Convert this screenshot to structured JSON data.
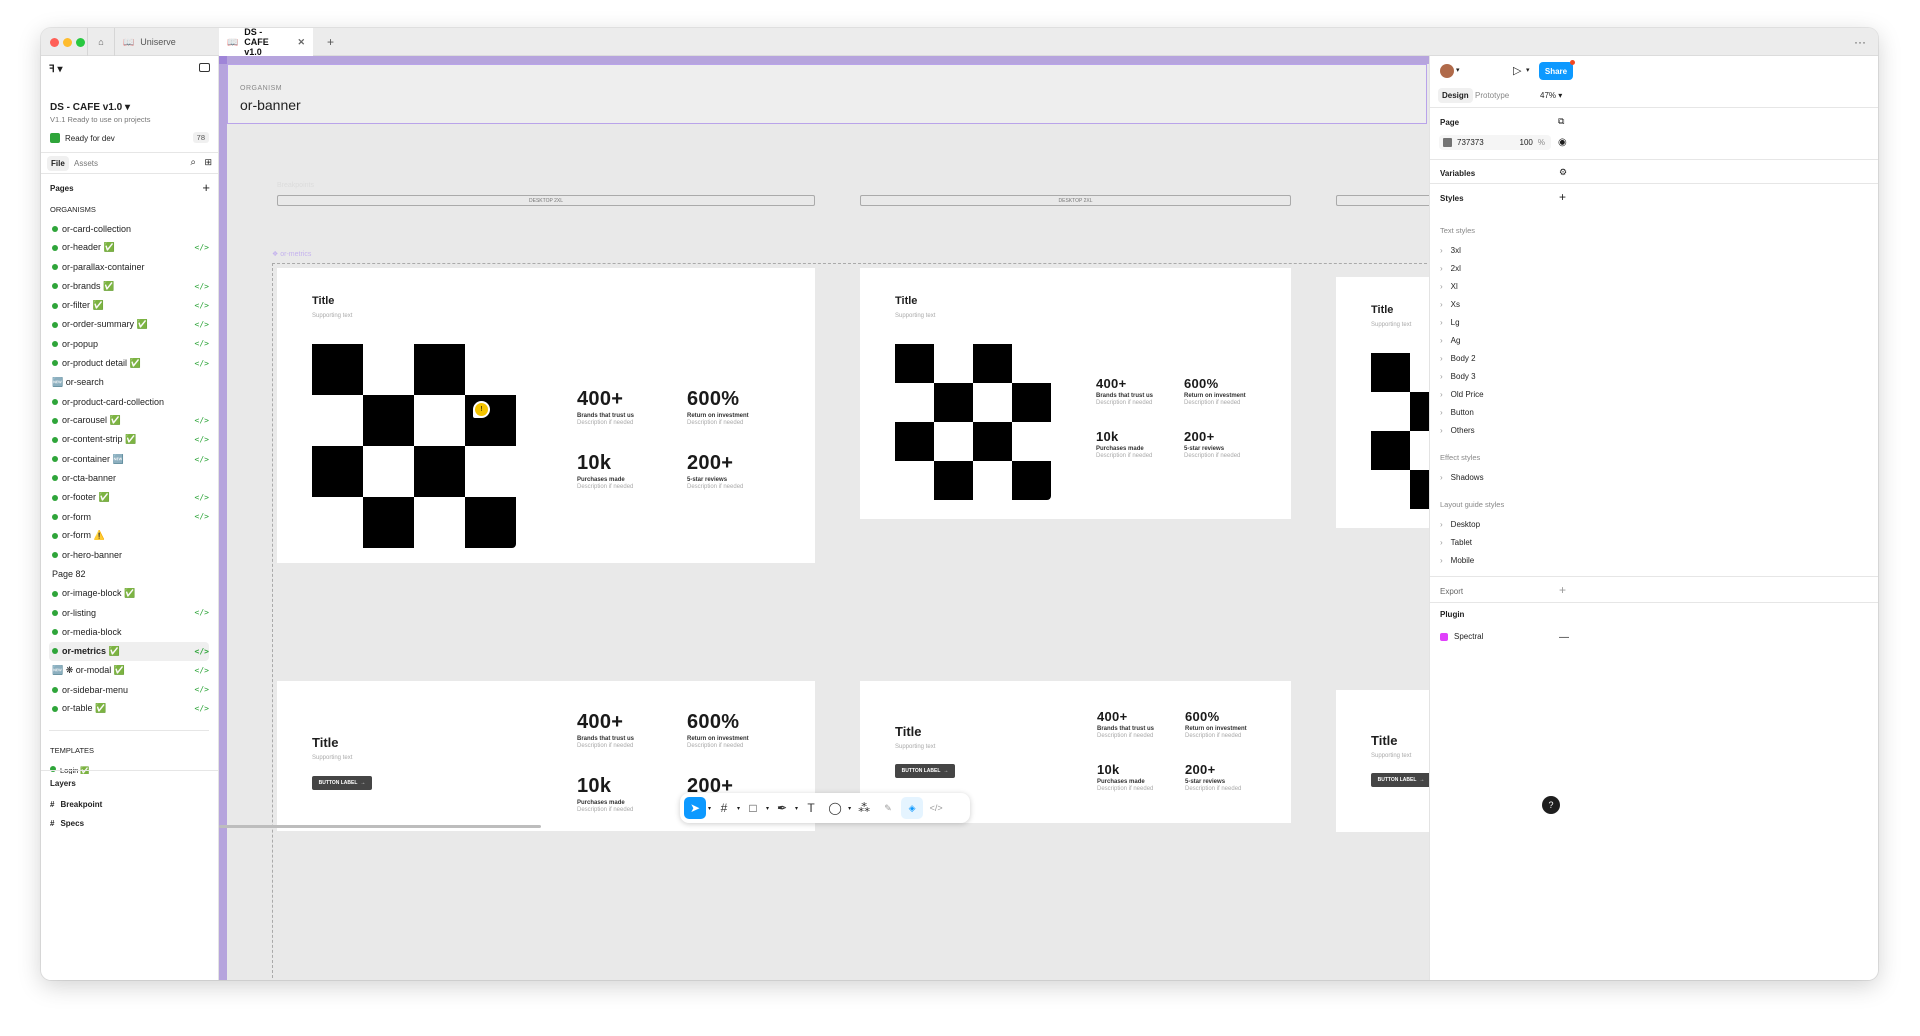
{
  "tabs": {
    "uniserve": "Uniserve",
    "file": "DS - CAFE v1.0",
    "plus": "+",
    "more": "···"
  },
  "left": {
    "file_title": "DS - CAFE v1.0",
    "subtitle": "V1.1 Ready to use on projects",
    "ready": "Ready for dev",
    "ready_count": "78",
    "file_tab": "File",
    "assets_tab": "Assets",
    "pages_label": "Pages",
    "pages": [
      {
        "label": "ORGANISMS",
        "kind": "section"
      },
      {
        "label": "or-card-collection",
        "kind": "page",
        "code": false
      },
      {
        "label": "or-header ✅",
        "kind": "page",
        "code": true
      },
      {
        "label": "or-parallax-container",
        "kind": "page",
        "code": false
      },
      {
        "label": "or-brands ✅",
        "kind": "page",
        "code": true
      },
      {
        "label": "or-filter ✅",
        "kind": "page",
        "code": true
      },
      {
        "label": "or-order-summary ✅",
        "kind": "page",
        "code": true
      },
      {
        "label": "or-popup",
        "kind": "page",
        "code": true
      },
      {
        "label": "or-product detail ✅",
        "kind": "page",
        "code": true
      },
      {
        "label": "🆕 or-search",
        "kind": "plain",
        "code": false
      },
      {
        "label": "or-product-card-collection",
        "kind": "page",
        "code": false
      },
      {
        "label": "or-carousel ✅",
        "kind": "page",
        "code": true
      },
      {
        "label": "or-content-strip ✅",
        "kind": "page",
        "code": true
      },
      {
        "label": "or-container 🆕",
        "kind": "page",
        "code": true
      },
      {
        "label": "or-cta-banner",
        "kind": "page",
        "code": false
      },
      {
        "label": "or-footer ✅",
        "kind": "page",
        "code": true
      },
      {
        "label": "or-form",
        "kind": "page",
        "code": true
      },
      {
        "label": "or-form ⚠️",
        "kind": "page",
        "code": false
      },
      {
        "label": "or-hero-banner",
        "kind": "page",
        "code": false
      },
      {
        "label": "Page 82",
        "kind": "plain",
        "code": false
      },
      {
        "label": "or-image-block ✅",
        "kind": "page",
        "code": false
      },
      {
        "label": "or-listing",
        "kind": "page",
        "code": true
      },
      {
        "label": "or-media-block",
        "kind": "page",
        "code": false
      },
      {
        "label": "or-metrics ✅",
        "kind": "page",
        "code": true,
        "selected": true
      },
      {
        "label": "🆕 ❋ or-modal ✅",
        "kind": "plain",
        "code": true
      },
      {
        "label": "or-sidebar-menu",
        "kind": "page",
        "code": true
      },
      {
        "label": "or-table ✅",
        "kind": "page",
        "code": true
      }
    ],
    "templates_label": "TEMPLATES",
    "login": "Login ✅",
    "layers_label": "Layers",
    "layers": [
      "Breakpoint",
      "Specs"
    ]
  },
  "canvas": {
    "organism_label": "ORGANISM",
    "banner_title": "or-banner",
    "faded_label": "Breakpoints",
    "desktop_label": "DESKTOP 2XL",
    "metrics_label": "❖ or-metrics",
    "title": "Title",
    "supporting": "Supporting text",
    "button": "BUTTON LABEL",
    "metrics": [
      {
        "value": "400+",
        "label": "Brands that trust us",
        "desc": "Description if needed"
      },
      {
        "value": "600%",
        "label": "Return on investment",
        "desc": "Description if needed"
      },
      {
        "value": "10k",
        "label": "Purchases made",
        "desc": "Description if needed"
      },
      {
        "value": "200+",
        "label": "5-star reviews",
        "desc": "Description if needed"
      }
    ],
    "comment_badge": "!"
  },
  "right": {
    "design_tab": "Design",
    "prototype_tab": "Prototype",
    "zoom": "47%",
    "share": "Share",
    "page_label": "Page",
    "page_color": "737373",
    "page_opacity": "100",
    "percent": "%",
    "variables": "Variables",
    "styles": "Styles",
    "text_styles_label": "Text styles",
    "text_styles": [
      "3xl",
      "2xl",
      "Xl",
      "Xs",
      "Lg",
      "Ag",
      "Body 2",
      "Body 3",
      "Old Price",
      "Button",
      "Others"
    ],
    "effect_styles_label": "Effect styles",
    "effect_styles": [
      "Shadows"
    ],
    "layout_styles_label": "Layout guide styles",
    "layout_styles": [
      "Desktop",
      "Tablet",
      "Mobile"
    ],
    "export": "Export",
    "plugin": "Plugin",
    "plugin_name": "Spectral",
    "help": "?"
  },
  "colors": {
    "accent": "#0d99ff",
    "purple": "#8d6bd3",
    "green": "#2fa53a",
    "page_swatch": "#737373"
  }
}
